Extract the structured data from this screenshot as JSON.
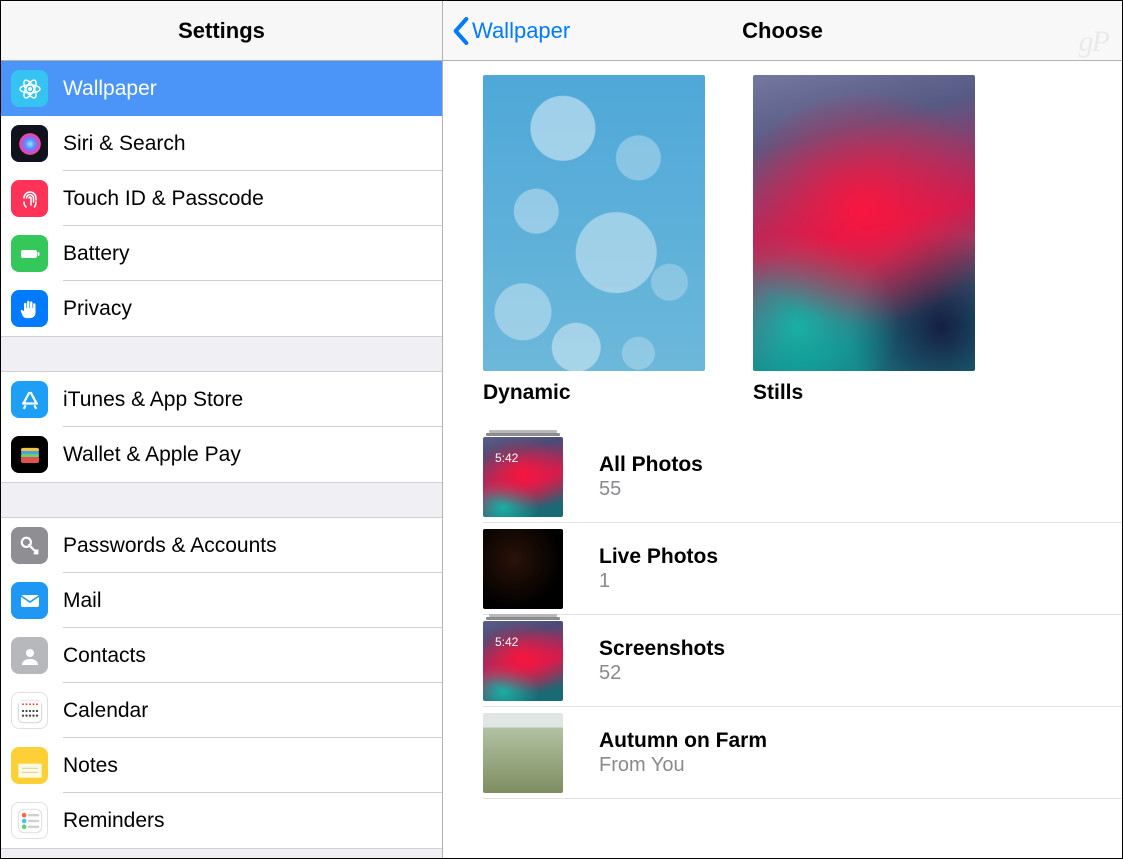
{
  "sidebar": {
    "title": "Settings",
    "groups": [
      {
        "items": [
          {
            "id": "wallpaper",
            "label": "Wallpaper",
            "icon": "wallpaper",
            "color": "#35c3f1",
            "selected": true
          },
          {
            "id": "siri",
            "label": "Siri & Search",
            "icon": "siri",
            "color": "#10121d"
          },
          {
            "id": "touchid",
            "label": "Touch ID & Passcode",
            "icon": "fingerprint",
            "color": "#ff3358"
          },
          {
            "id": "battery",
            "label": "Battery",
            "icon": "battery",
            "color": "#34c759"
          },
          {
            "id": "privacy",
            "label": "Privacy",
            "icon": "hand",
            "color": "#007aff"
          }
        ]
      },
      {
        "items": [
          {
            "id": "itunes",
            "label": "iTunes & App Store",
            "icon": "appstore",
            "color": "#1d9ff6"
          },
          {
            "id": "wallet",
            "label": "Wallet & Apple Pay",
            "icon": "wallet",
            "color": "#000000"
          }
        ]
      },
      {
        "items": [
          {
            "id": "passwords",
            "label": "Passwords & Accounts",
            "icon": "key",
            "color": "#8e8e93"
          },
          {
            "id": "mail",
            "label": "Mail",
            "icon": "mail",
            "color": "#1f97f4"
          },
          {
            "id": "contacts",
            "label": "Contacts",
            "icon": "contacts",
            "color": "#b7b8bb"
          },
          {
            "id": "calendar",
            "label": "Calendar",
            "icon": "calendar",
            "color": "#ffffff"
          },
          {
            "id": "notes",
            "label": "Notes",
            "icon": "notes",
            "color": "#fed035"
          },
          {
            "id": "reminders",
            "label": "Reminders",
            "icon": "reminders",
            "color": "#ffffff"
          }
        ]
      }
    ]
  },
  "detail": {
    "back_label": "Wallpaper",
    "title": "Choose",
    "categories": [
      {
        "id": "dynamic",
        "label": "Dynamic",
        "thumb": "dynamic-bg"
      },
      {
        "id": "stills",
        "label": "Stills",
        "thumb": "stills-bg"
      }
    ],
    "albums": [
      {
        "id": "all",
        "title": "All Photos",
        "subtitle": "55",
        "thumb": "stills-mini",
        "stack": true,
        "time": "5:42"
      },
      {
        "id": "live",
        "title": "Live Photos",
        "subtitle": "1",
        "thumb": "live-mini",
        "stack": false
      },
      {
        "id": "shots",
        "title": "Screenshots",
        "subtitle": "52",
        "thumb": "stills-mini",
        "stack": true,
        "time": "5:42"
      },
      {
        "id": "autumn",
        "title": "Autumn on Farm",
        "subtitle": "From You",
        "thumb": "farm-mini",
        "stack": true
      }
    ]
  },
  "watermark": "gP"
}
